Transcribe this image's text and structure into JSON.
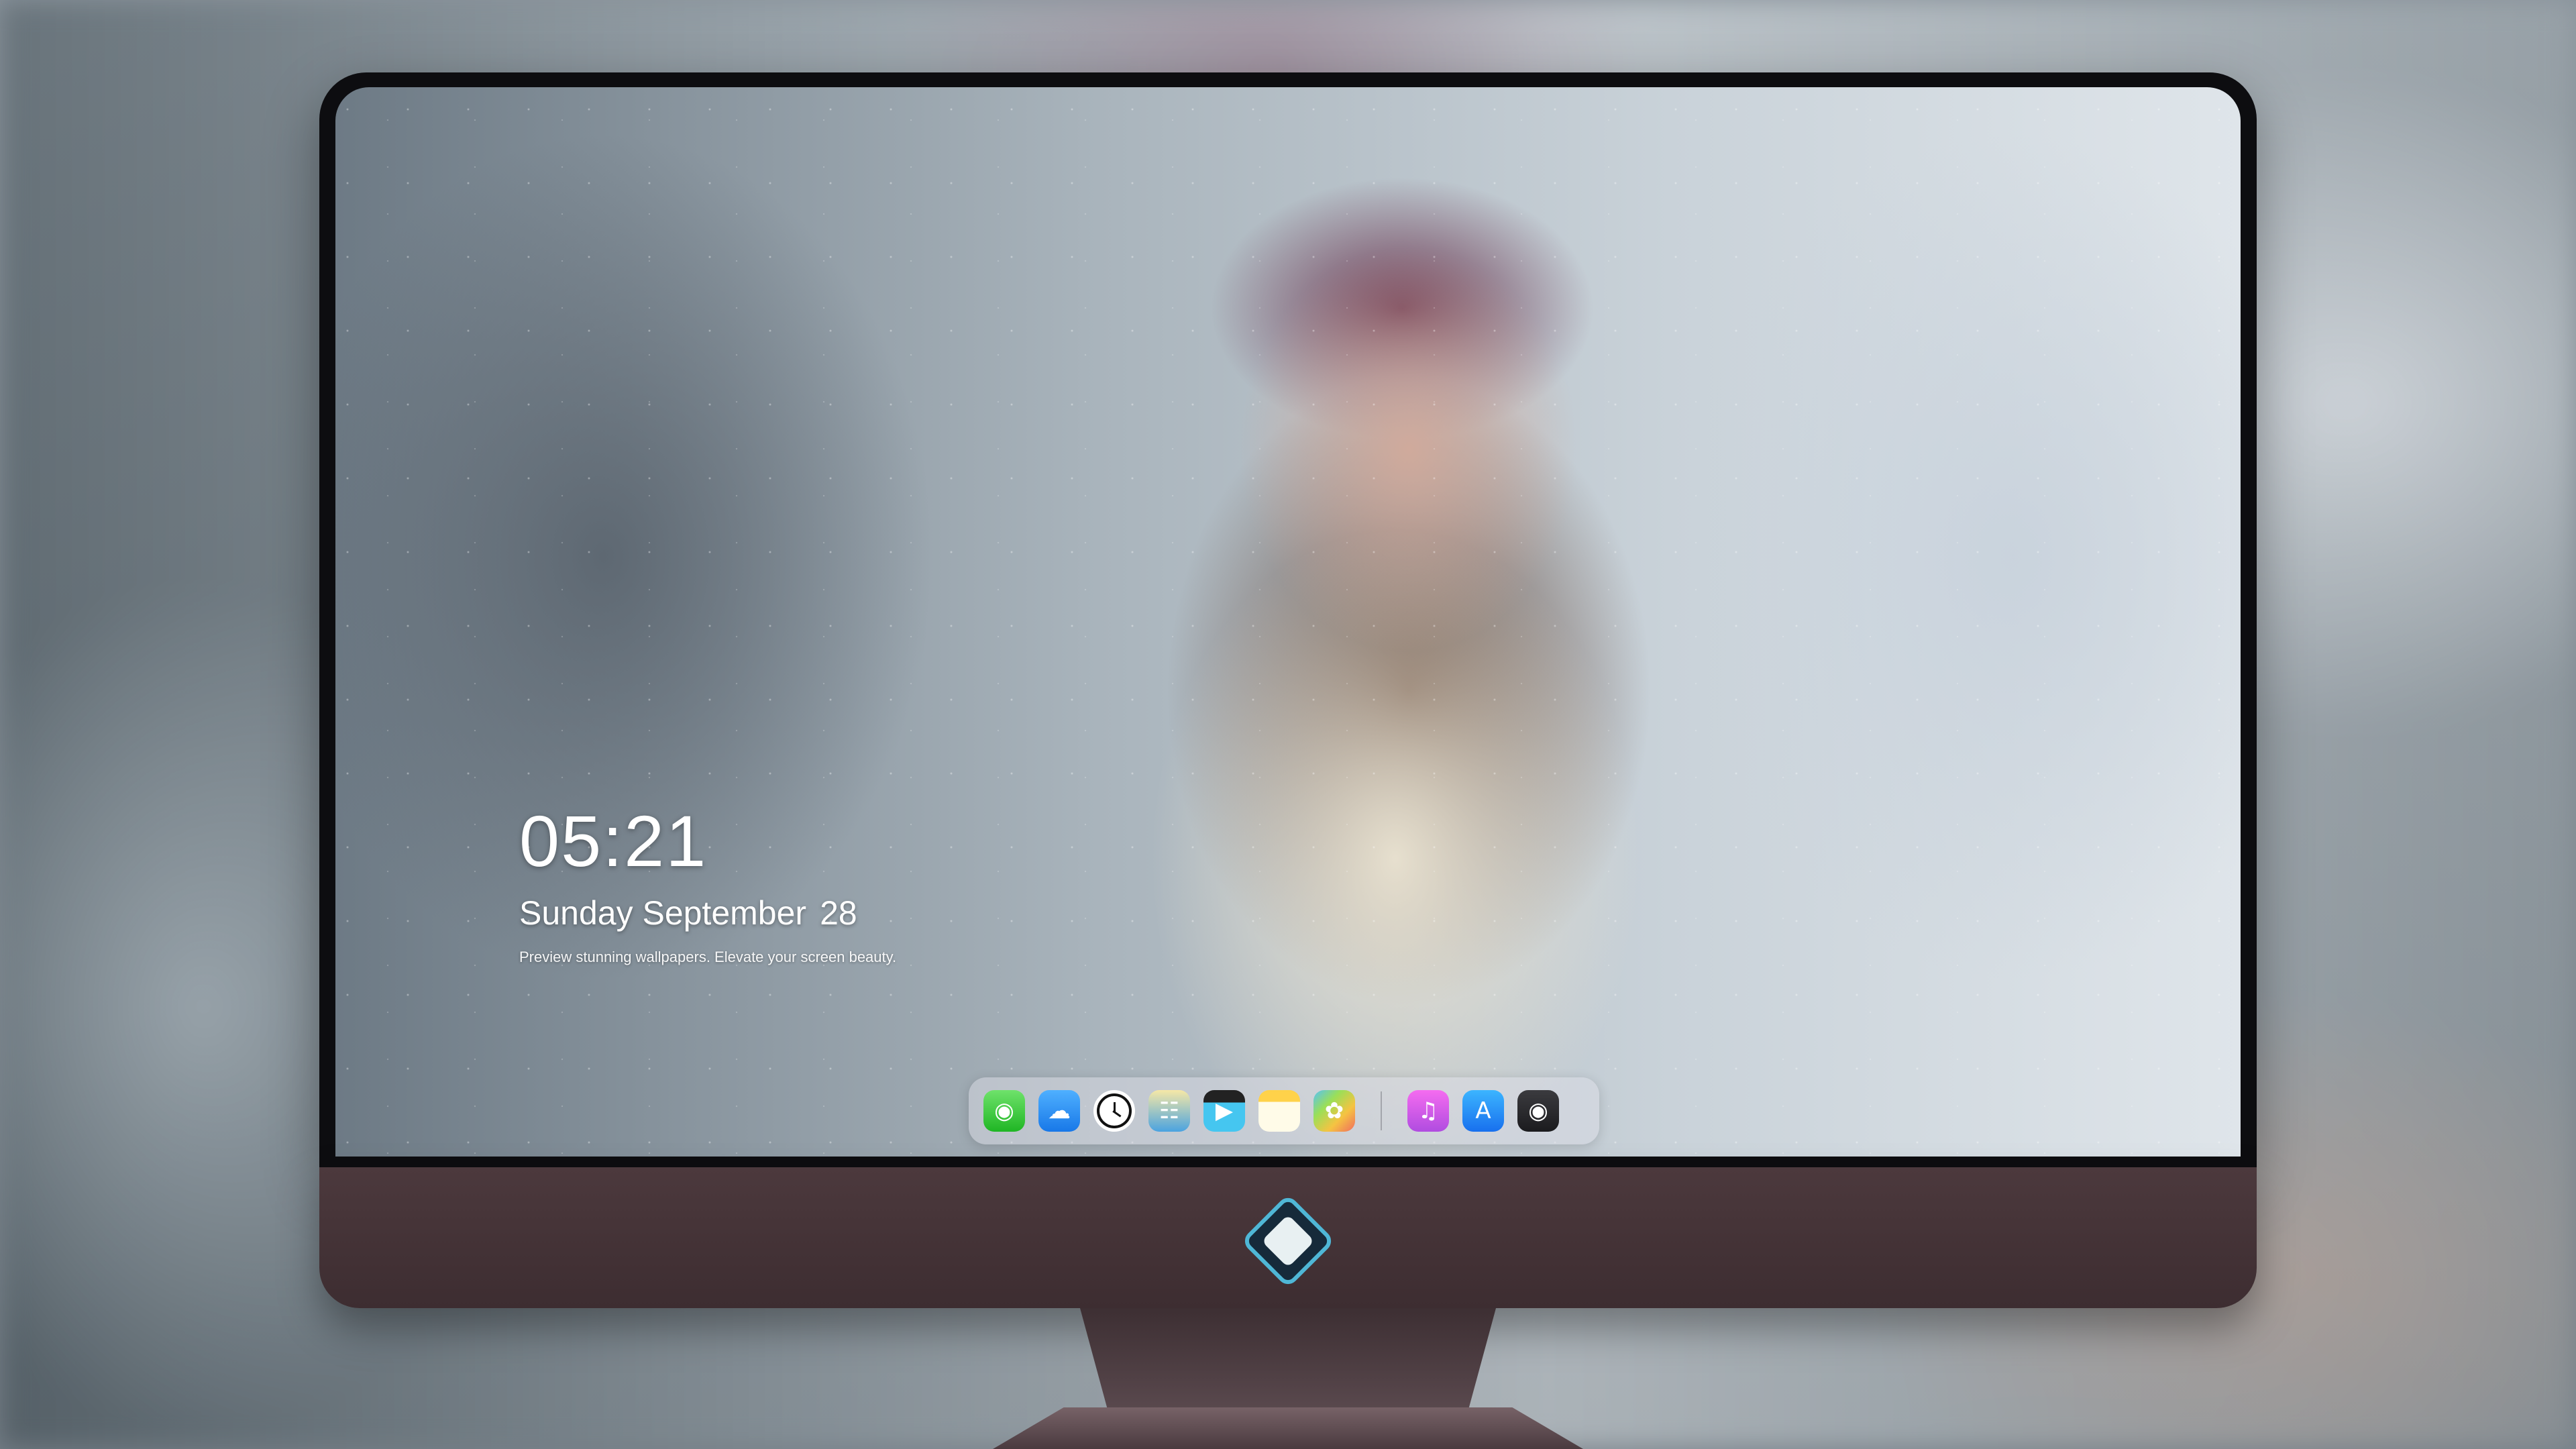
{
  "lockscreen": {
    "time": "05:21",
    "weekday_month": "Sunday September",
    "day": "28",
    "promo": "Preview stunning wallpapers. Elevate your screen beauty."
  },
  "dock": {
    "apps": [
      {
        "name": "messages-icon",
        "color": "#2bc23a"
      },
      {
        "name": "weather-icon",
        "color": "#2a8cf2"
      },
      {
        "name": "clock-icon",
        "color": "#111111"
      },
      {
        "name": "preview-icon",
        "color": "#4aa3e0"
      },
      {
        "name": "video-icon",
        "color": "#45c6f0"
      },
      {
        "name": "notes-icon",
        "color": "#ffd24a"
      },
      {
        "name": "photos-icon",
        "color": "#9adf58"
      },
      {
        "name": "music-icon",
        "color": "#d45ce8"
      },
      {
        "name": "app-store-icon",
        "color": "#2792f5"
      },
      {
        "name": "camera-icon",
        "color": "#2a2a2e"
      }
    ]
  },
  "colors": {
    "bezel": "#0d0d10",
    "chin": "#45343a",
    "logo_accent": "#4fb7d6"
  }
}
